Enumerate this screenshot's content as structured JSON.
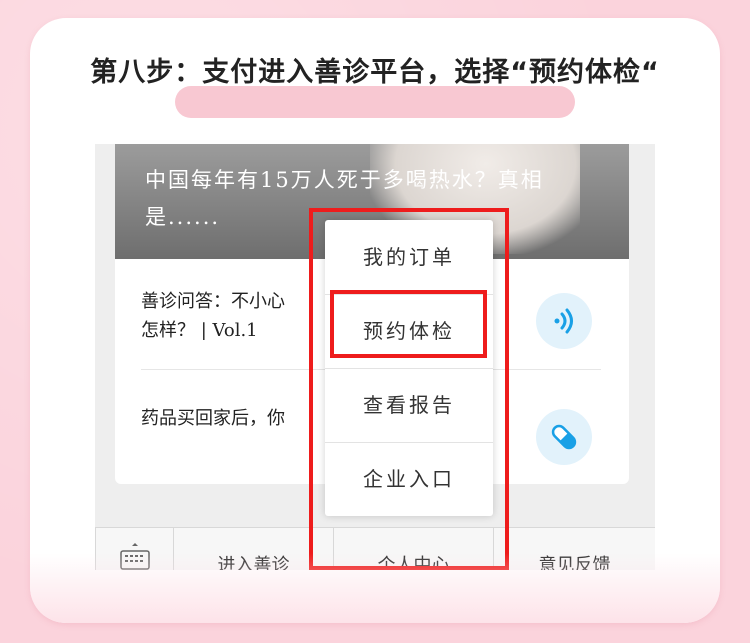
{
  "header": {
    "step_title": "第八步：支付进入善诊平台，选择“预约体检“"
  },
  "banner": {
    "headline": "中国每年有15万人死于多喝热水？真相是......"
  },
  "articles": [
    {
      "line1": "善诊问答：不小心",
      "line2": "怎样？ | Vol.1",
      "icon": "audio-wave-icon"
    },
    {
      "line1": "药品买回家后，你",
      "line2": "",
      "icon": "pill-capsule-icon"
    }
  ],
  "tabbar": {
    "keyboard_icon": "keyboard-icon",
    "tabs": [
      "进入善诊",
      "个人中心",
      "意见反馈"
    ]
  },
  "menu": {
    "items": [
      "我的订单",
      "预约体检",
      "查看报告",
      "企业入口"
    ],
    "highlighted_item": "预约体检"
  },
  "colors": {
    "page_background": "#fbd3dc",
    "title_highlight": "#f8c8d2",
    "annotation_red": "#ee1c1c",
    "icon_blue": "#19a0e6"
  }
}
